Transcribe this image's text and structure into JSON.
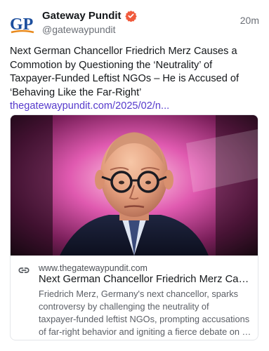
{
  "author": {
    "display_name": "Gateway Pundit",
    "handle": "@gatewaypundit",
    "avatar_text": "GP",
    "verified": true
  },
  "post": {
    "timestamp": "20m",
    "text_lines": [
      "Next German Chancellor Friedrich Merz Causes a",
      "Commotion by Questioning the ‘Neutrality’ of",
      "Taxpayer-Funded Leftist NGOs – He is Accused of",
      "‘Behaving Like the Far-Right’"
    ],
    "link_text": "thegatewaypundit.com/2025/02/n..."
  },
  "card": {
    "domain": "www.thegatewaypundit.com",
    "title": "Next German Chancellor Friedrich Merz Causes a Commotion by Questioning the ‘Neutrality’ of Taxpayer-Funded Leftist NGOs",
    "description_lines": [
      "Friedrich Merz, Germany's next chancellor, sparks",
      "controversy by challenging the neutrality of",
      "taxpayer-funded leftist NGOs, prompting accusations",
      "of far-right behavior and igniting a fierce debate on public funding."
    ]
  },
  "colors": {
    "link": "#563acc",
    "avatar_blue": "#1d4f9e",
    "avatar_orange": "#e8891c",
    "verified_badge": "#f05a3c"
  },
  "icons": {
    "verified": "verified-badge-icon",
    "link": "link-chain-icon"
  }
}
